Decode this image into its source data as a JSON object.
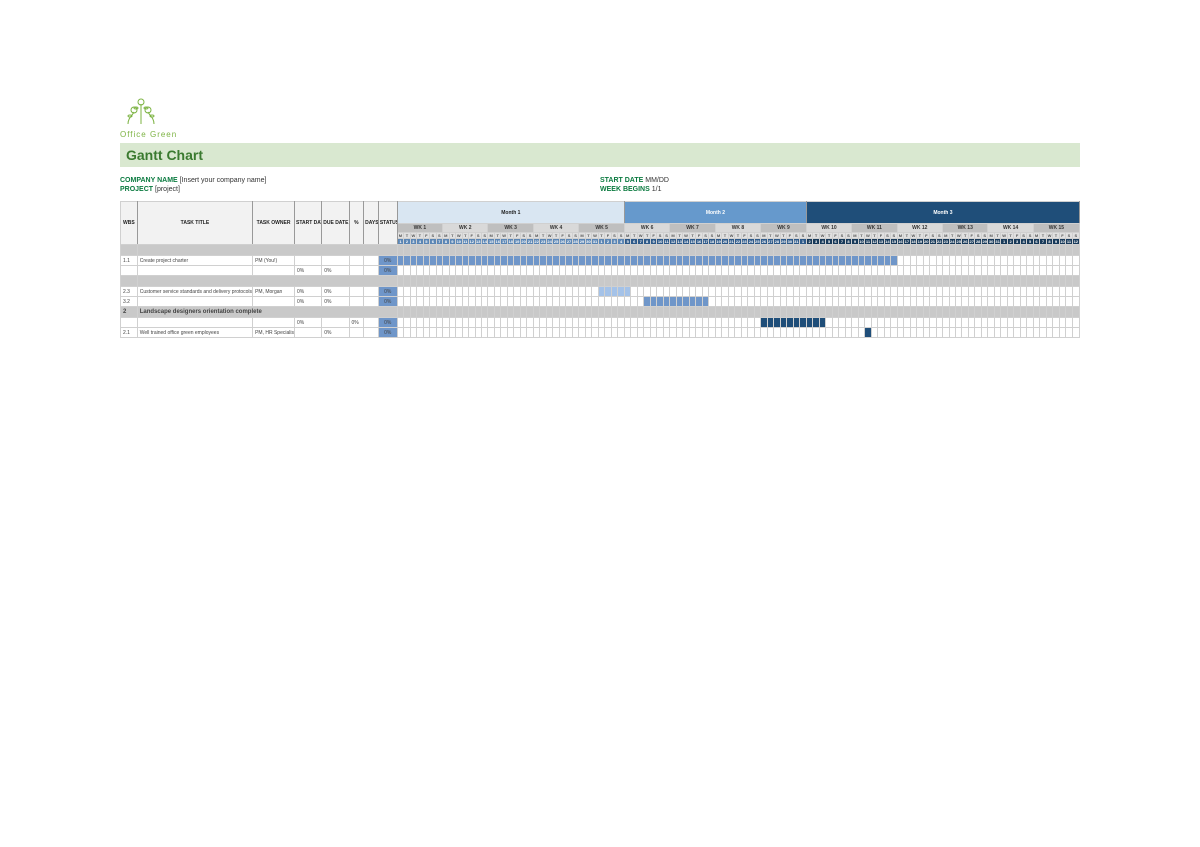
{
  "logo_text": "Office Green",
  "title": "Gantt Chart",
  "meta": {
    "left1_label": "COMPANY NAME",
    "left1_value": "[Insert your company name]",
    "left2_label": "PROJECT",
    "left2_value": "[project]",
    "right1_label": "START DATE",
    "right1_value": "MM/DD",
    "right2_label": "WEEK BEGINS",
    "right2_value": "1/1"
  },
  "headers": {
    "col1": "WBS",
    "col2": "TASK TITLE",
    "col3": "TASK OWNER",
    "col4": "START DATE",
    "col5": "DUE DATE",
    "col6": "%",
    "col7": "DAYS",
    "col8": "STATUS"
  },
  "months": [
    "Month 1",
    "Month 2",
    "Month 3"
  ],
  "weeks": [
    "WK 1",
    "WK 2",
    "WK 3",
    "WK 4",
    "WK 5",
    "WK 6",
    "WK 7",
    "WK 8",
    "WK 9",
    "WK 10",
    "WK 11",
    "WK 12",
    "WK 13",
    "WK 14",
    "WK 15"
  ],
  "dow": [
    "M",
    "T",
    "W",
    "T",
    "F",
    "S",
    "S"
  ],
  "section_a": "",
  "task1": {
    "wbs": "1.1",
    "title": "Create project charter",
    "owner": "PM (You!)",
    "start": "",
    "due": "",
    "pct": "",
    "days": "",
    "status": "0%",
    "bar_start": 0,
    "bar_len": 77,
    "bar_class": "bar-b"
  },
  "task2": {
    "wbs": "",
    "title": "",
    "owner": "",
    "start": "0%",
    "due": "0%",
    "pct": "",
    "days": "",
    "status": "0%",
    "bar_start": 0,
    "bar_len": 0
  },
  "section_b": "",
  "task3": {
    "wbs": "2.3",
    "title": "Customer service standards and delivery protocols drafted",
    "owner": "PM, Morgan",
    "start": "0%",
    "due": "0%",
    "pct": "",
    "days": "",
    "status": "0%",
    "bar_start": 31,
    "bar_len": 5,
    "bar_class": "bar-a"
  },
  "task4": {
    "wbs": "3.2",
    "title": "",
    "owner": "",
    "start": "0%",
    "due": "0%",
    "pct": "",
    "days": "",
    "status": "0%",
    "bar_start": 38,
    "bar_len": 10,
    "bar_class": "bar-b"
  },
  "section_c": {
    "wbs": "2",
    "title": "Landscape designers orientation complete"
  },
  "task5": {
    "wbs": "",
    "title": "",
    "owner": "",
    "start": "0%",
    "due": "",
    "pct": "0%",
    "days": "",
    "status": "0%",
    "bar_start": 56,
    "bar_len": 10,
    "bar_class": "bar-c"
  },
  "task6": {
    "wbs": "2.1",
    "title": "Well trained office green employees",
    "owner": "PM, HR Specialist, Morgan",
    "start": "",
    "due": "0%",
    "pct": "",
    "days": "",
    "status": "0%",
    "bar_start": 72,
    "bar_len": 1,
    "bar_class": "bar-c"
  }
}
